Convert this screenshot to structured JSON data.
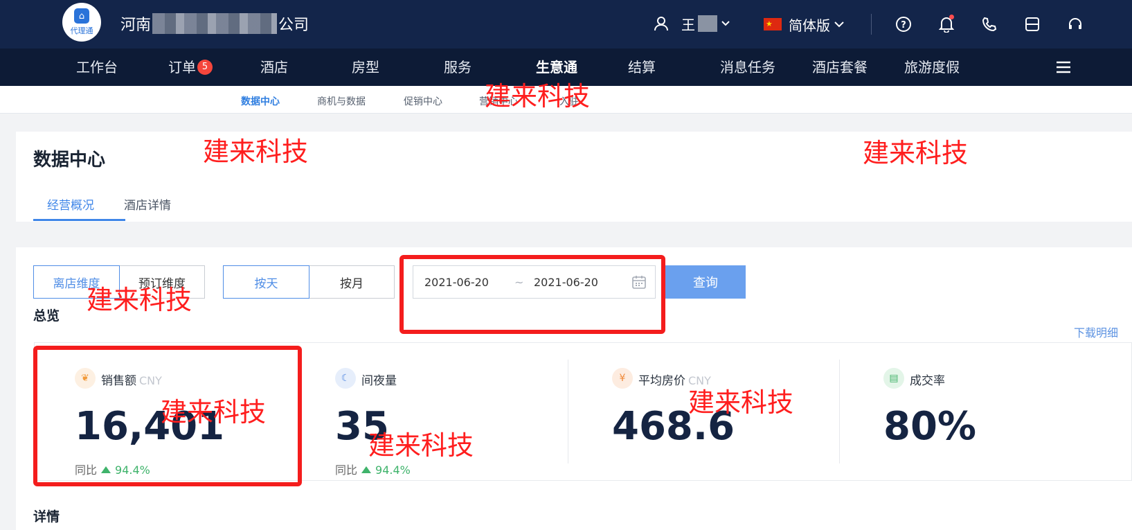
{
  "header": {
    "logo_text": "代理通",
    "company_prefix": "河南",
    "company_suffix": "公司",
    "user_name": "王",
    "language": "简体版"
  },
  "nav": {
    "items": [
      {
        "label": "工作台"
      },
      {
        "label": "订单",
        "badge": "5"
      },
      {
        "label": "酒店"
      },
      {
        "label": "房型"
      },
      {
        "label": "服务"
      },
      {
        "label": "生意通",
        "active": true
      },
      {
        "label": "结算"
      },
      {
        "label": "消息任务"
      },
      {
        "label": "酒店套餐"
      },
      {
        "label": "旅游度假"
      }
    ]
  },
  "subnav": {
    "items": [
      {
        "label": "数据中心",
        "active": true
      },
      {
        "label": "商机与数据"
      },
      {
        "label": "促销中心"
      },
      {
        "label": "营销中心"
      },
      {
        "label": "入驻"
      }
    ]
  },
  "page": {
    "title": "数据中心",
    "tabs": [
      {
        "label": "经营概况",
        "active": true
      },
      {
        "label": "酒店详情"
      }
    ]
  },
  "filters": {
    "dimension": [
      "离店维度",
      "预订维度"
    ],
    "granularity": [
      "按天",
      "按月"
    ],
    "date_start": "2021-06-20",
    "date_separator": "~",
    "date_end": "2021-06-20",
    "query_label": "查询"
  },
  "overview": {
    "title": "总览",
    "download_label": "下载明细",
    "stats": [
      {
        "label": "销售额",
        "unit": "CNY",
        "value": "16,401",
        "compare_label": "同比",
        "compare_value": "94.4%"
      },
      {
        "label": "间夜量",
        "unit": "",
        "value": "35",
        "compare_label": "同比",
        "compare_value": "94.4%"
      },
      {
        "label": "平均房价",
        "unit": "CNY",
        "value": "468.6"
      },
      {
        "label": "成交率",
        "unit": "",
        "value": "80%"
      }
    ]
  },
  "details": {
    "title": "详情"
  },
  "annotations": {
    "watermark": "建来科技"
  },
  "colors": {
    "header_bg": "#13254a",
    "nav_bg": "#0d1b36",
    "accent": "#3f86e8",
    "annotation_red": "#f41d1d",
    "up_green": "#3fb36b"
  }
}
